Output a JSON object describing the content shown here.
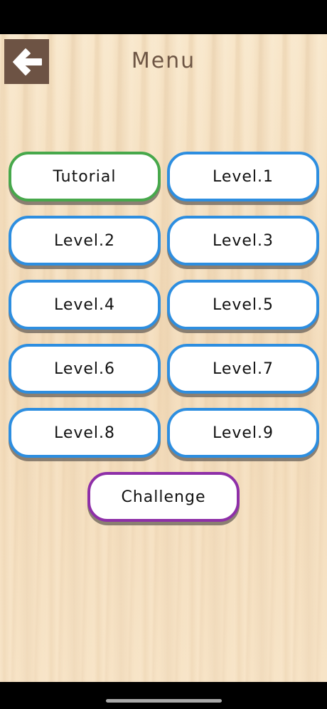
{
  "header": {
    "title": "Menu",
    "back_icon": "arrow-left-icon"
  },
  "menu": {
    "tutorial": "Tutorial",
    "levels": [
      "Level.1",
      "Level.2",
      "Level.3",
      "Level.4",
      "Level.5",
      "Level.6",
      "Level.7",
      "Level.8",
      "Level.9"
    ],
    "challenge": "Challenge"
  },
  "colors": {
    "tutorial_border": "#47a84b",
    "level_border": "#2d8ee0",
    "challenge_border": "#8e2fa8",
    "back_button_bg": "#6d5344",
    "title_text": "#6e5645"
  }
}
